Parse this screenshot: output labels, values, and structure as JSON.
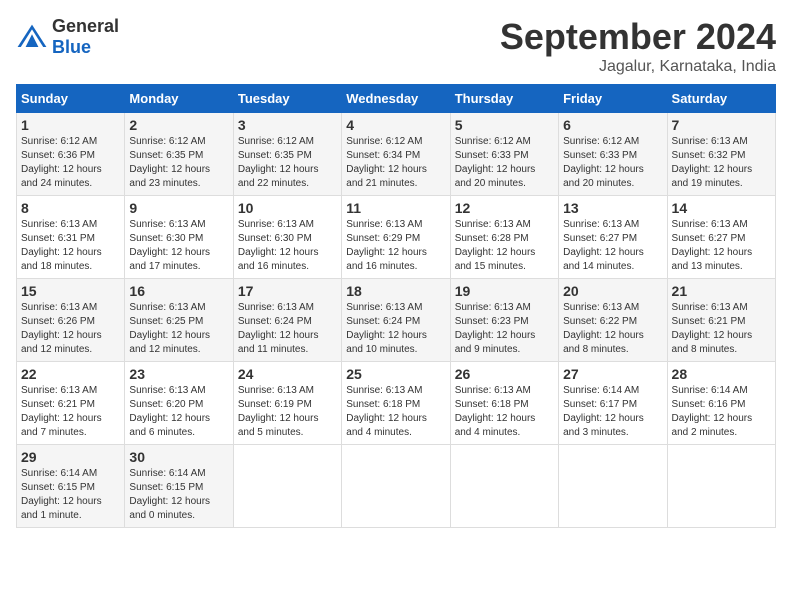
{
  "header": {
    "logo_general": "General",
    "logo_blue": "Blue",
    "month_title": "September 2024",
    "location": "Jagalur, Karnataka, India"
  },
  "weekdays": [
    "Sunday",
    "Monday",
    "Tuesday",
    "Wednesday",
    "Thursday",
    "Friday",
    "Saturday"
  ],
  "weeks": [
    [
      {
        "day": "1",
        "sunrise": "6:12 AM",
        "sunset": "6:36 PM",
        "daylight": "12 hours and 24 minutes."
      },
      {
        "day": "2",
        "sunrise": "6:12 AM",
        "sunset": "6:35 PM",
        "daylight": "12 hours and 23 minutes."
      },
      {
        "day": "3",
        "sunrise": "6:12 AM",
        "sunset": "6:35 PM",
        "daylight": "12 hours and 22 minutes."
      },
      {
        "day": "4",
        "sunrise": "6:12 AM",
        "sunset": "6:34 PM",
        "daylight": "12 hours and 21 minutes."
      },
      {
        "day": "5",
        "sunrise": "6:12 AM",
        "sunset": "6:33 PM",
        "daylight": "12 hours and 20 minutes."
      },
      {
        "day": "6",
        "sunrise": "6:12 AM",
        "sunset": "6:33 PM",
        "daylight": "12 hours and 20 minutes."
      },
      {
        "day": "7",
        "sunrise": "6:13 AM",
        "sunset": "6:32 PM",
        "daylight": "12 hours and 19 minutes."
      }
    ],
    [
      {
        "day": "8",
        "sunrise": "6:13 AM",
        "sunset": "6:31 PM",
        "daylight": "12 hours and 18 minutes."
      },
      {
        "day": "9",
        "sunrise": "6:13 AM",
        "sunset": "6:30 PM",
        "daylight": "12 hours and 17 minutes."
      },
      {
        "day": "10",
        "sunrise": "6:13 AM",
        "sunset": "6:30 PM",
        "daylight": "12 hours and 16 minutes."
      },
      {
        "day": "11",
        "sunrise": "6:13 AM",
        "sunset": "6:29 PM",
        "daylight": "12 hours and 16 minutes."
      },
      {
        "day": "12",
        "sunrise": "6:13 AM",
        "sunset": "6:28 PM",
        "daylight": "12 hours and 15 minutes."
      },
      {
        "day": "13",
        "sunrise": "6:13 AM",
        "sunset": "6:27 PM",
        "daylight": "12 hours and 14 minutes."
      },
      {
        "day": "14",
        "sunrise": "6:13 AM",
        "sunset": "6:27 PM",
        "daylight": "12 hours and 13 minutes."
      }
    ],
    [
      {
        "day": "15",
        "sunrise": "6:13 AM",
        "sunset": "6:26 PM",
        "daylight": "12 hours and 12 minutes."
      },
      {
        "day": "16",
        "sunrise": "6:13 AM",
        "sunset": "6:25 PM",
        "daylight": "12 hours and 12 minutes."
      },
      {
        "day": "17",
        "sunrise": "6:13 AM",
        "sunset": "6:24 PM",
        "daylight": "12 hours and 11 minutes."
      },
      {
        "day": "18",
        "sunrise": "6:13 AM",
        "sunset": "6:24 PM",
        "daylight": "12 hours and 10 minutes."
      },
      {
        "day": "19",
        "sunrise": "6:13 AM",
        "sunset": "6:23 PM",
        "daylight": "12 hours and 9 minutes."
      },
      {
        "day": "20",
        "sunrise": "6:13 AM",
        "sunset": "6:22 PM",
        "daylight": "12 hours and 8 minutes."
      },
      {
        "day": "21",
        "sunrise": "6:13 AM",
        "sunset": "6:21 PM",
        "daylight": "12 hours and 8 minutes."
      }
    ],
    [
      {
        "day": "22",
        "sunrise": "6:13 AM",
        "sunset": "6:21 PM",
        "daylight": "12 hours and 7 minutes."
      },
      {
        "day": "23",
        "sunrise": "6:13 AM",
        "sunset": "6:20 PM",
        "daylight": "12 hours and 6 minutes."
      },
      {
        "day": "24",
        "sunrise": "6:13 AM",
        "sunset": "6:19 PM",
        "daylight": "12 hours and 5 minutes."
      },
      {
        "day": "25",
        "sunrise": "6:13 AM",
        "sunset": "6:18 PM",
        "daylight": "12 hours and 4 minutes."
      },
      {
        "day": "26",
        "sunrise": "6:13 AM",
        "sunset": "6:18 PM",
        "daylight": "12 hours and 4 minutes."
      },
      {
        "day": "27",
        "sunrise": "6:14 AM",
        "sunset": "6:17 PM",
        "daylight": "12 hours and 3 minutes."
      },
      {
        "day": "28",
        "sunrise": "6:14 AM",
        "sunset": "6:16 PM",
        "daylight": "12 hours and 2 minutes."
      }
    ],
    [
      {
        "day": "29",
        "sunrise": "6:14 AM",
        "sunset": "6:15 PM",
        "daylight": "12 hours and 1 minute."
      },
      {
        "day": "30",
        "sunrise": "6:14 AM",
        "sunset": "6:15 PM",
        "daylight": "12 hours and 0 minutes."
      },
      null,
      null,
      null,
      null,
      null
    ]
  ]
}
